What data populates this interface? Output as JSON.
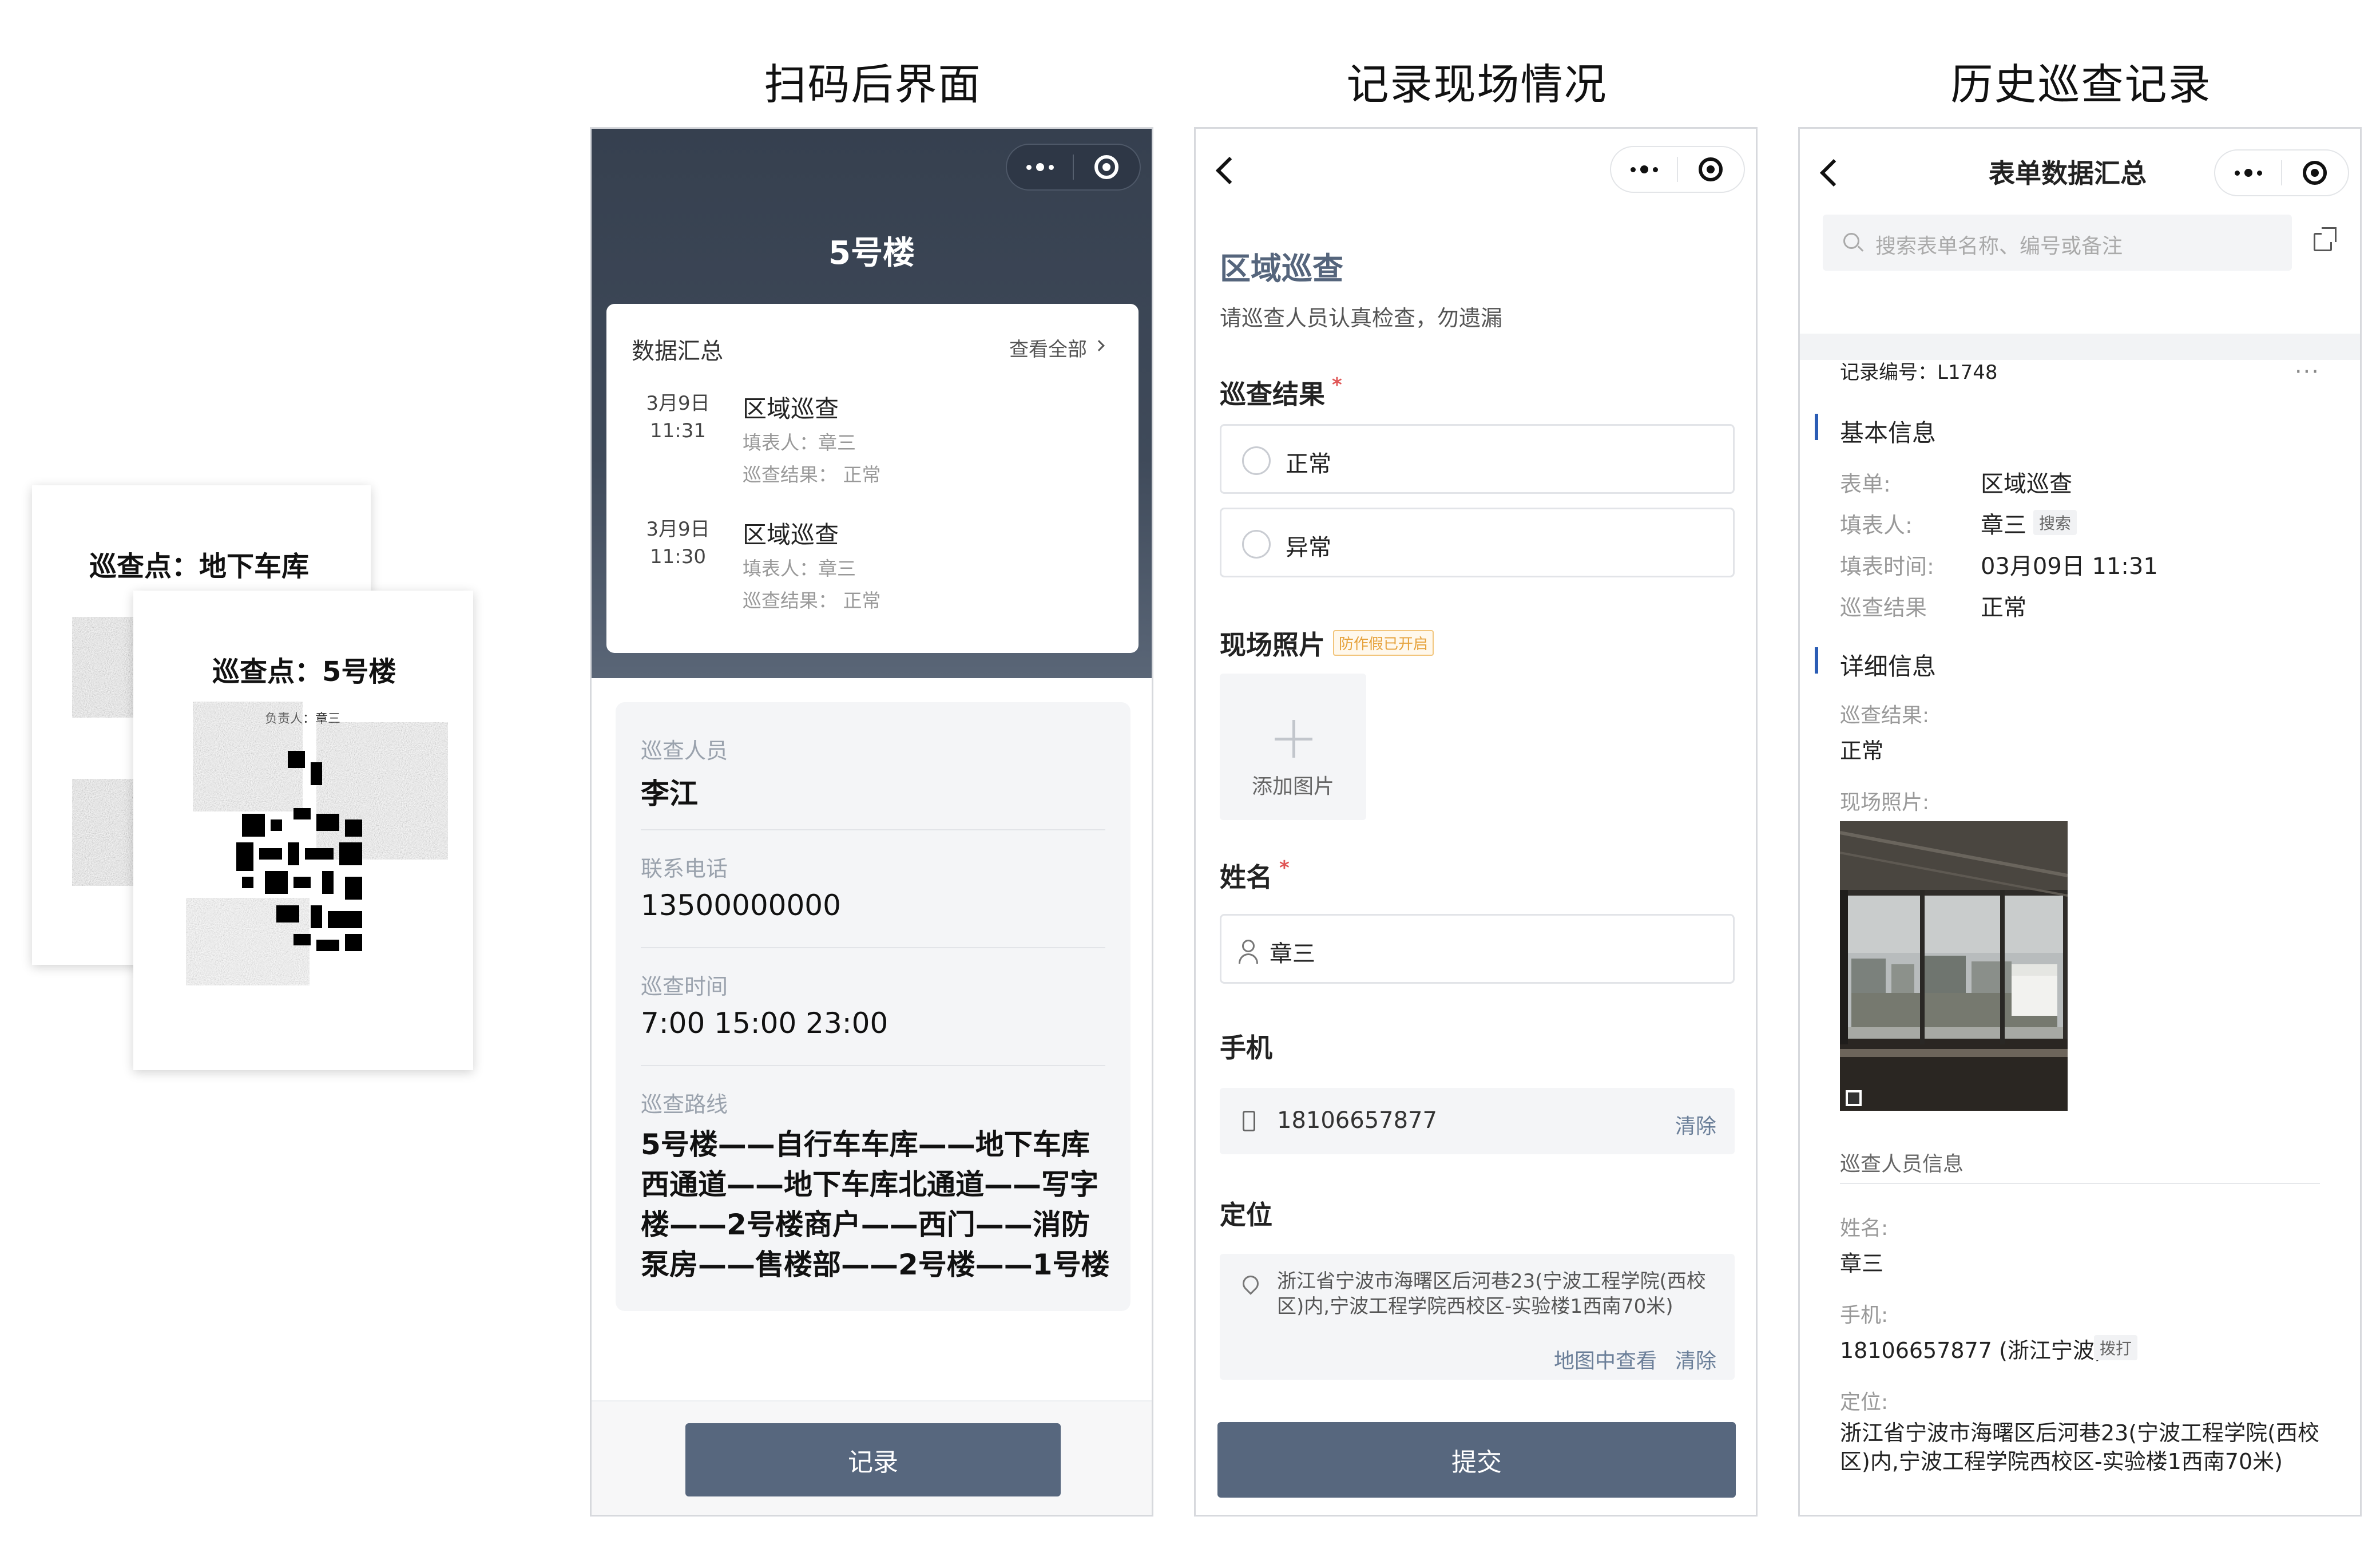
{
  "section_titles": [
    "扫码后界面",
    "记录现场情况",
    "历史巡查记录"
  ],
  "posters": {
    "back_title": "巡查点：地下车库",
    "front_title": "巡查点：5号楼",
    "front_small_text": "负责人：章三"
  },
  "screen1": {
    "title": "5号楼",
    "summary": {
      "heading": "数据汇总",
      "view_all": "查看全部",
      "entries": [
        {
          "date": "3月9日",
          "time": "11:31",
          "title": "区域巡查",
          "filler": "填表人：章三",
          "result": "巡查结果： 正常"
        },
        {
          "date": "3月9日",
          "time": "11:30",
          "title": "区域巡查",
          "filler": "填表人：章三",
          "result": "巡查结果： 正常"
        }
      ]
    },
    "info": {
      "inspector_label": "巡查人员",
      "inspector_value": "李江",
      "phone_label": "联系电话",
      "phone_value": "13500000000",
      "time_label": "巡查时间",
      "time_value": "7:00 15:00 23:00",
      "route_label": "巡查路线",
      "route_value": "5号楼——自行车车库——地下车库西通道——地下车库北通道——写字楼——2号楼商户——西门——消防泵房——售楼部——2号楼——1号楼"
    },
    "record_button": "记录"
  },
  "screen2": {
    "form_title": "区域巡查",
    "form_desc": "请巡查人员认真检查，勿遗漏",
    "result_label": "巡查结果",
    "required_mark": "*",
    "options": [
      "正常",
      "异常"
    ],
    "photo_label": "现场照片",
    "anti_fake_badge": "防作假已开启",
    "add_photo": "添加图片",
    "name_label": "姓名",
    "name_value": "章三",
    "mobile_label": "手机",
    "mobile_value": "18106657877",
    "clear": "清除",
    "location_label": "定位",
    "location_value": "浙江省宁波市海曙区后河巷23(宁波工程学院(西校区)内,宁波工程学院西校区-实验楼1西南70米)",
    "view_map": "地图中查看",
    "submit_button": "提交"
  },
  "screen3": {
    "title": "表单数据汇总",
    "search_placeholder": "搜索表单名称、编号或备注",
    "record_no": "记录编号：L1748",
    "more": "···",
    "basic_info": "基本信息",
    "form_key": "表单:",
    "form_val": "区域巡查",
    "filler_key": "填表人:",
    "filler_val": "章三",
    "search_tag": "搜索",
    "time_key": "填表时间:",
    "time_val": "03月09日 11:31",
    "result_key": "巡查结果",
    "result_val": "正常",
    "detail_info": "详细信息",
    "detail_result_key": "巡查结果:",
    "detail_result_val": "正常",
    "photo_key": "现场照片:",
    "inspector_info": "巡查人员信息",
    "name_key": "姓名:",
    "name_val": "章三",
    "mobile_key": "手机:",
    "mobile_val": "18106657877 (浙江宁波)",
    "dial_tag": "拨打",
    "location_key": "定位:",
    "location_val": "浙江省宁波市海曙区后河巷23(宁波工程学院(西校区)内,宁波工程学院西校区-实验楼1西南70米)"
  },
  "colors": {
    "header_dark": "#36404f",
    "button": "#57677e",
    "accent_title": "#55657c",
    "section_bar": "#2b5db5",
    "badge": "#e6a23c"
  }
}
